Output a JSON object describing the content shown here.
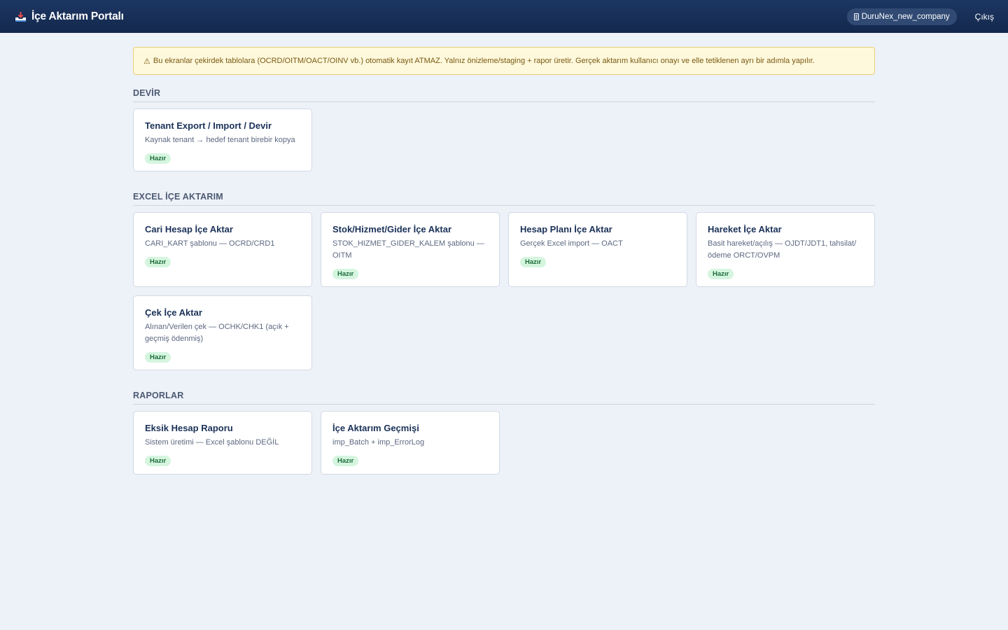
{
  "header": {
    "title": "İçe Aktarım Portalı",
    "company": "DuruNex_new_company",
    "logout_label": "Çıkış"
  },
  "warning": {
    "icon": "⚠",
    "text": "Bu ekranlar çekirdek tablolara (OCRD/OITM/OACT/OINV vb.) otomatik kayıt ATMAZ. Yalnız önizleme/staging + rapor üretir. Gerçek aktarım kullanıcı onayı ve elle tetiklenen ayrı bir adımla yapılır."
  },
  "sections": {
    "devir": {
      "title": "DEVİR",
      "cards": [
        {
          "title": "Tenant Export / Import / Devir",
          "desc": "Kaynak tenant → hedef tenant birebir kopya",
          "badge": "Hazır"
        }
      ]
    },
    "excel": {
      "title": "EXCEL İÇE AKTARIM",
      "cards": [
        {
          "title": "Cari Hesap İçe Aktar",
          "desc": "CARI_KART şablonu — OCRD/CRD1",
          "badge": "Hazır"
        },
        {
          "title": "Stok/Hizmet/Gider İçe Aktar",
          "desc": "STOK_HIZMET_GIDER_KALEM şablonu — OITM",
          "badge": "Hazır"
        },
        {
          "title": "Hesap Planı İçe Aktar",
          "desc": "Gerçek Excel import — OACT",
          "badge": "Hazır"
        },
        {
          "title": "Hareket İçe Aktar",
          "desc": "Basit hareket/açılış — OJDT/JDT1, tahsilat/ödeme ORCT/OVPM",
          "badge": "Hazır"
        },
        {
          "title": "Çek İçe Aktar",
          "desc": "Alınan/Verilen çek — OCHK/CHK1 (açık + geçmiş ödenmiş)",
          "badge": "Hazır"
        }
      ]
    },
    "raporlar": {
      "title": "RAPORLAR",
      "cards": [
        {
          "title": "Eksik Hesap Raporu",
          "desc": "Sistem üretimi — Excel şablonu DEĞİL",
          "badge": "Hazır"
        },
        {
          "title": "İçe Aktarım Geçmişi",
          "desc": "imp_Batch + imp_ErrorLog",
          "badge": "Hazır"
        }
      ]
    }
  },
  "colors": {
    "header_bg": "#1d3764",
    "page_bg": "#edf1f8",
    "warning_bg": "#fef8dc",
    "badge_bg": "#d5f5df",
    "badge_text": "#1b6b39"
  }
}
